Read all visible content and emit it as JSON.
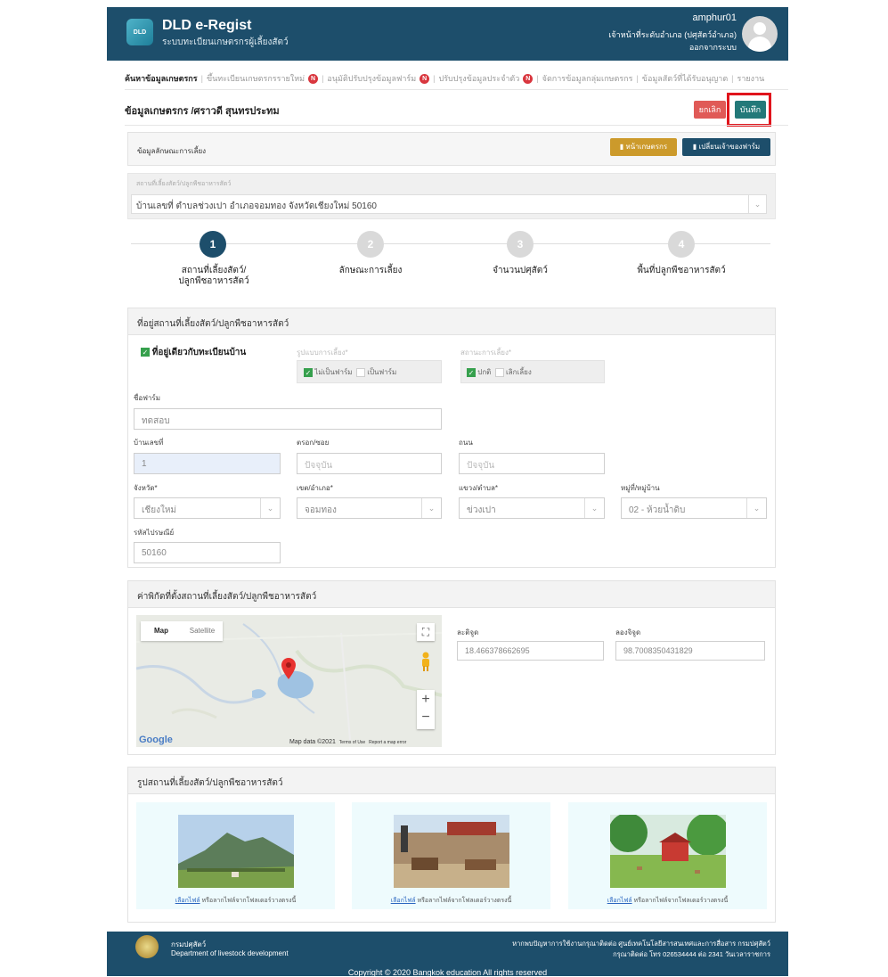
{
  "header": {
    "logo_text": "DLD",
    "title": "DLD e-Regist",
    "subtitle": "ระบบทะเบียนเกษตรกรผู้เลี้ยงสัตว์",
    "user_name": "amphur01",
    "user_role": "เจ้าหน้าที่ระดับอำเภอ (ปศุสัตว์อำเภอ)",
    "logout": "ออกจากระบบ"
  },
  "nav": {
    "items": [
      {
        "label": "ค้นหาข้อมูลเกษตรกร",
        "active": true,
        "badge": ""
      },
      {
        "label": "ขึ้นทะเบียนเกษตรกรรายใหม่",
        "active": false,
        "badge": "N"
      },
      {
        "label": "อนุมัติปรับปรุงข้อมูลฟาร์ม",
        "active": false,
        "badge": "N"
      },
      {
        "label": "ปรับปรุงข้อมูลประจำตัว",
        "active": false,
        "badge": "N"
      },
      {
        "label": "จัดการข้อมูลกลุ่มเกษตรกร",
        "active": false,
        "badge": ""
      },
      {
        "label": "ข้อมูลสัตว์ที่ได้รับอนุญาต",
        "active": false,
        "badge": ""
      },
      {
        "label": "รายงาน",
        "active": false,
        "badge": ""
      }
    ]
  },
  "page": {
    "breadcrumb": "ข้อมูลเกษตรกร /ศราวดี สุนทรประทม",
    "cancel": "ยกเลิก",
    "save": "บันทึก"
  },
  "raising": {
    "title": "ข้อมูลลักษณะการเลี้ยง",
    "btn_farmer": "หน้าเกษตรกร",
    "btn_change_owner": "เปลี่ยนเจ้าของฟาร์ม",
    "location_label": "สถานที่เลี้ยงสัตว์/ปลูกพืชอาหารสัตว์",
    "location_value": "บ้านเลขที่ ตำบลช่วงเปา อำเภอจอมทอง จังหวัดเชียงใหม่ 50160"
  },
  "steps": [
    {
      "num": "1",
      "label": "สถานที่เลี้ยงสัตว์/ ปลูกพืชอาหารสัตว์",
      "active": true
    },
    {
      "num": "2",
      "label": "ลักษณะการเลี้ยง",
      "active": false
    },
    {
      "num": "3",
      "label": "จำนวนปศุสัตว์",
      "active": false
    },
    {
      "num": "4",
      "label": "พื้นที่ปลูกพืชอาหารสัตว์",
      "active": false
    }
  ],
  "address": {
    "title": "ที่อยู่สถานที่เลี้ยงสัตว์/ปลูกพืชอาหารสัตว์",
    "same_as_house": "ที่อยู่เดียวกับทะเบียนบ้าน",
    "farm_type_label": "รูปแบบการเลี้ยง*",
    "farm_type_opt1": "ไม่เป็นฟาร์ม",
    "farm_type_opt2": "เป็นฟาร์ม",
    "status_label": "สถานะการเลี้ยง*",
    "status_opt1": "ปกติ",
    "status_opt2": "เลิกเลี้ยง",
    "farm_name_label": "ชื่อฟาร์ม",
    "farm_name_value": "ทดสอบ",
    "house_no_label": "บ้านเลขที่",
    "house_no_value": "1",
    "alley_label": "ตรอก/ซอย",
    "alley_placeholder": "ปัจจุบัน",
    "road_label": "ถนน",
    "road_placeholder": "ปัจจุบัน",
    "province_label": "จังหวัด*",
    "province_value": "เชียงใหม่",
    "district_label": "เขต/อำเภอ*",
    "district_value": "จอมทอง",
    "subdistrict_label": "แขวง/ตำบล*",
    "subdistrict_value": "ข่วงเปา",
    "village_label": "หมู่ที่/หมู่บ้าน",
    "village_value": "02 - ห้วยน้ำดิบ",
    "postcode_label": "รหัสไปรษณีย์",
    "postcode_value": "50160"
  },
  "coords": {
    "title": "ค่าพิกัดที่ตั้งสถานที่เลี้ยงสัตว์/ปลูกพืชอาหารสัตว์",
    "map_tab": "Map",
    "satellite_tab": "Satellite",
    "google": "Google",
    "map_data": "Map data ©2021",
    "terms": "Terms of Use",
    "report": "Report a map error",
    "lat_label": "ละติจูด",
    "lat_value": "18.466378662695",
    "lng_label": "ลองจิจูด",
    "lng_value": "98.7008350431829"
  },
  "photos": {
    "title": "รูปสถานที่เลี้ยงสัตว์/ปลูกพืชอาหารสัตว์",
    "link": "เลือกไฟล์",
    "caption": "หรือลากไฟล์จากโฟลเดอร์วางตรงนี้"
  },
  "footer": {
    "org_th": "กรมปศุสัตว์",
    "org_en": "Department of livestock development",
    "contact1": "หากพบปัญหาการใช้งานกรุณาติดต่อ ศูนย์เทคโนโลยีสารสนเทศและการสื่อสาร กรมปศุสัตว์",
    "contact2": "กรุณาติดต่อ โทร 026534444 ต่อ 2341 วันเวลาราชการ",
    "copyright": "Copyright © 2020 Bangkok education All rights reserved"
  },
  "colors": {
    "header": "#1d4e6b",
    "save": "#237979",
    "cancel": "#e05a57",
    "step_active": "#1d4e6b",
    "step_inactive": "#d9d9d9"
  }
}
